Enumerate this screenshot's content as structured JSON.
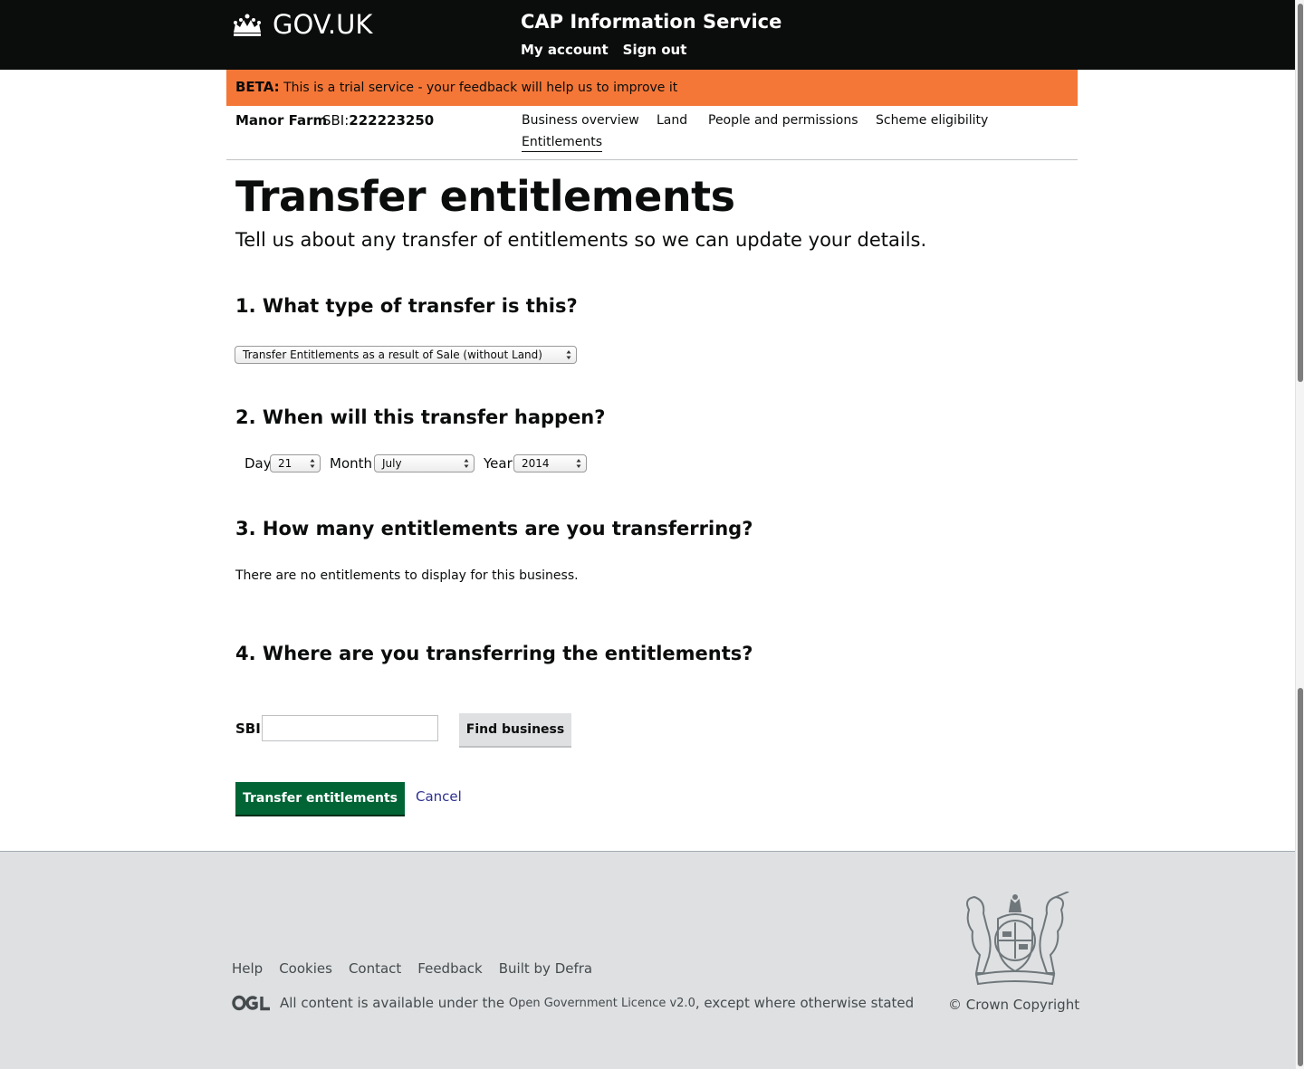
{
  "header": {
    "logo_text": "GOV.UK",
    "service_name": "CAP Information Service",
    "links": [
      "My account",
      "Sign out"
    ]
  },
  "beta": {
    "tag": "BETA:",
    "text_before": "This is a trial service - your",
    "link": "feedback",
    "text_after": "will help us to improve it"
  },
  "business": {
    "name": "Manor Farm",
    "sbi_label": "SBI:",
    "sbi_value": "222223250",
    "nav": [
      "Business overview",
      "Land",
      "People and permissions",
      "Scheme eligibility",
      "Entitlements"
    ],
    "active_nav": "Entitlements"
  },
  "main": {
    "title": "Transfer entitlements",
    "lede": "Tell us about any transfer of entitlements so we can update your details.",
    "q1": {
      "heading": "1. What type of transfer is this?",
      "selected": "Transfer Entitlements as a result of Sale (without Land)"
    },
    "q2": {
      "heading": "2. When will this transfer happen?",
      "day_label": "Day",
      "day_value": "21",
      "month_label": "Month",
      "month_value": "July",
      "year_label": "Year",
      "year_value": "2014"
    },
    "q3": {
      "heading": "3. How many entitlements are you transferring?",
      "message": "There are no entitlements to display for this business."
    },
    "q4": {
      "heading": "4. Where are you transferring the entitlements?",
      "sbi_label": "SBI",
      "sbi_value": "",
      "find_button": "Find business"
    },
    "submit_button": "Transfer entitlements",
    "cancel_link": "Cancel"
  },
  "footer": {
    "links": [
      "Help",
      "Cookies",
      "Contact",
      "Feedback"
    ],
    "built_by_text": "Built by",
    "built_by_link": "Defra",
    "licence_before": "All content is available under the",
    "licence_link": "Open Government Licence v2.0",
    "licence_after": ", except where otherwise stated",
    "copyright": "© Crown Copyright"
  },
  "colors": {
    "header_bg": "#0b0c0c",
    "beta_bg": "#f47738",
    "primary_button": "#006435",
    "footer_bg": "#dee0e2",
    "link": "#2e3191"
  },
  "icons": [
    "crown-icon",
    "ogl-logo-icon",
    "royal-coat-of-arms-icon",
    "select-arrows-icon"
  ]
}
